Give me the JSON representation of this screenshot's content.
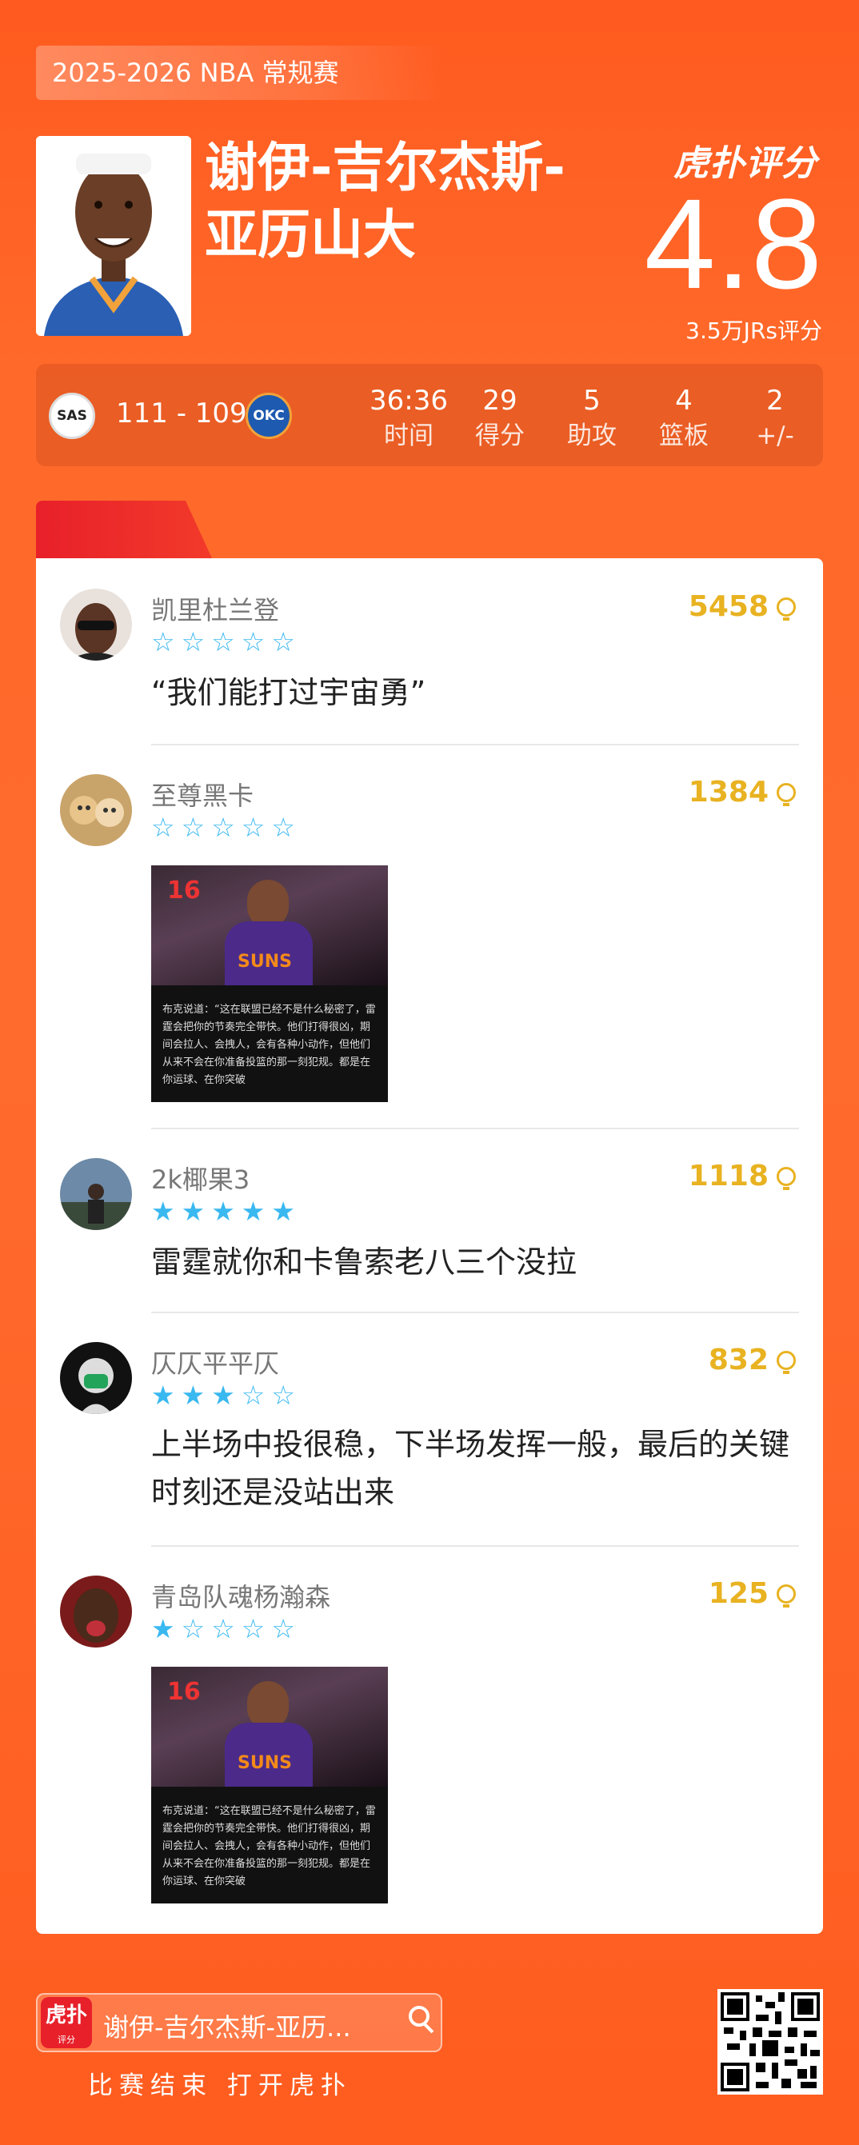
{
  "season": "2025-2026 NBA 常规赛",
  "player": {
    "name_line1": "谢伊-吉尔杰斯-",
    "name_line2": "亚历山大"
  },
  "brand": "虎扑评分",
  "rating": {
    "score": "4.8",
    "count": "3.5万JRs评分"
  },
  "game": {
    "team_home": "SAS",
    "team_away": "OKC",
    "score": "111 - 109",
    "stats": [
      {
        "value": "36:36",
        "label": "时间"
      },
      {
        "value": "29",
        "label": "得分"
      },
      {
        "value": "5",
        "label": "助攻"
      },
      {
        "value": "4",
        "label": "篮板"
      },
      {
        "value": "2",
        "label": "+/-"
      }
    ]
  },
  "comments": [
    {
      "user": "凯里杜兰登",
      "likes": "5458",
      "stars": 0,
      "text": "“我们能打过宇宙勇”"
    },
    {
      "user": "至尊黑卡",
      "likes": "1384",
      "stars": 0,
      "text": "",
      "image_caption": "布克说道：“这在联盟已经不是什么秘密了，雷霆会把你的节奏完全带快。他们打得很凶，期间会拉人、会拽人，会有各种小动作，但他们从来不会在你准备投篮的那一刻犯规。都是在你运球、在你突破"
    },
    {
      "user": "2k椰果3",
      "likes": "1118",
      "stars": 5,
      "text": "雷霆就你和卡鲁索老八三个没拉"
    },
    {
      "user": "仄仄平平仄",
      "likes": "832",
      "stars": 3,
      "text": "上半场中投很稳，下半场发挥一般，最后的关键时刻还是没站出来"
    },
    {
      "user": "青岛队魂杨瀚森",
      "likes": "125",
      "stars": 1,
      "text": "",
      "image_caption": "布克说道：“这在联盟已经不是什么秘密了，雷霆会把你的节奏完全带快。他们打得很凶，期间会拉人、会拽人，会有各种小动作，但他们从来不会在你准备投篮的那一刻犯规。都是在你运球、在你突破"
    }
  ],
  "image_jersey": "SUNS",
  "image_number": "16",
  "footer": {
    "app_icon": "虎扑",
    "app_icon_sub": "评分",
    "search_text": "谢伊-吉尔杰斯-亚历...",
    "caption": "比赛结束 打开虎扑"
  },
  "colors": {
    "background": "#ff5f22",
    "accent_star": "#3ab8f0",
    "likes": "#e8b221",
    "tab": "#e8202a"
  }
}
